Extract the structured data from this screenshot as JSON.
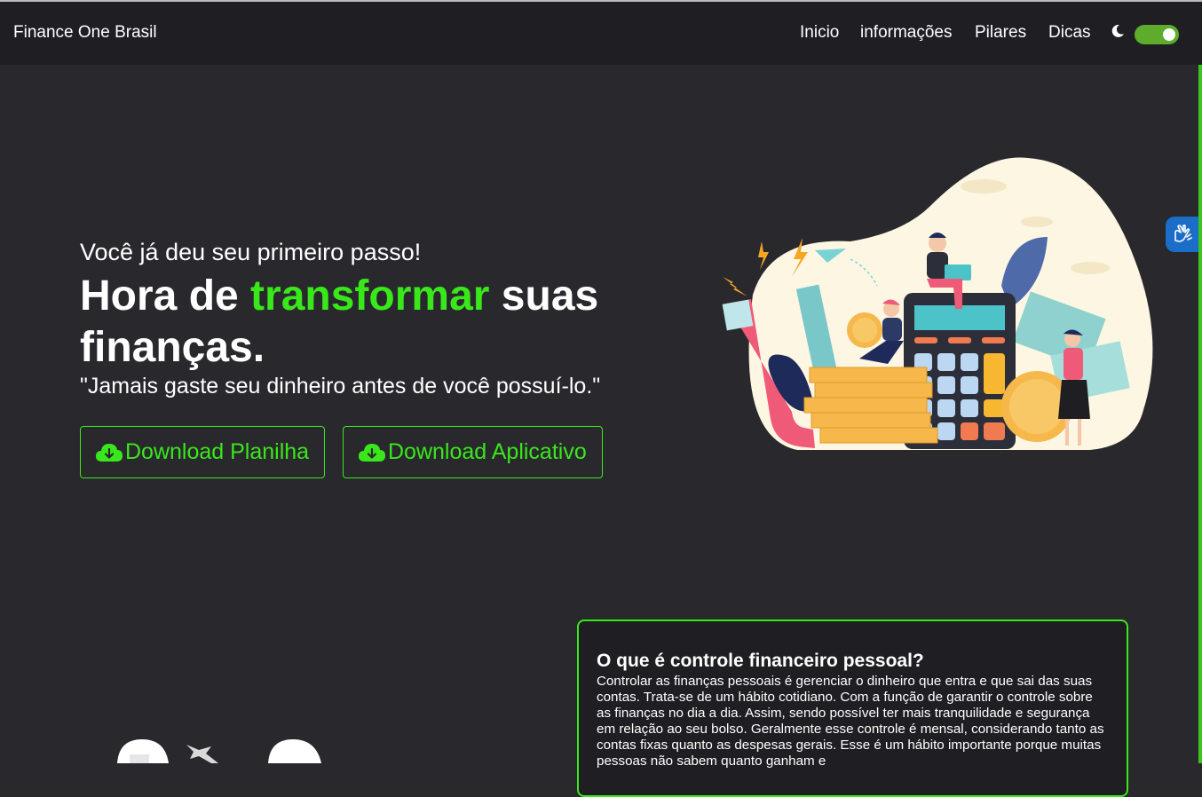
{
  "colors": {
    "background": "#29282d",
    "navbar": "#1f1e22",
    "accent": "#39e81b",
    "toggle": "#5dac2c",
    "accessibility_button": "#1b6dc7"
  },
  "navbar": {
    "brand": "Finance One Brasil",
    "links": [
      {
        "label": "Inicio"
      },
      {
        "label": "informações"
      },
      {
        "label": "Pilares"
      },
      {
        "label": "Dicas"
      }
    ],
    "theme_icon": "moon-icon",
    "dark_mode_on": true
  },
  "accessibility": {
    "icon": "sign-language-hands-icon"
  },
  "hero": {
    "intro": "Você já deu seu primeiro passo!",
    "title_pre": "Hora de ",
    "title_accent": "transformar",
    "title_post": " suas finanças.",
    "quote": "\"Jamais gaste seu dinheiro antes de você possuí-lo.\"",
    "buttons": [
      {
        "label": "Download Planilha",
        "icon": "cloud-download-icon"
      },
      {
        "label": "Download Aplicativo",
        "icon": "cloud-download-icon"
      }
    ],
    "illustration": "finance-illustration"
  },
  "info_card": {
    "title": "O que é controle financeiro pessoal?",
    "text": "Controlar as finanças pessoais é gerenciar o dinheiro que entra e que sai das suas contas. Trata-se de um hábito cotidiano. Com a função de garantir o controle sobre as finanças no dia a dia. Assim, sendo possível ter mais tranquilidade e segurança em relação ao seu bolso. Geralmente esse controle é mensal, considerando tanto as contas fixas quanto as despesas gerais. Esse é um hábito importante porque muitas pessoas não sabem quanto ganham e"
  }
}
